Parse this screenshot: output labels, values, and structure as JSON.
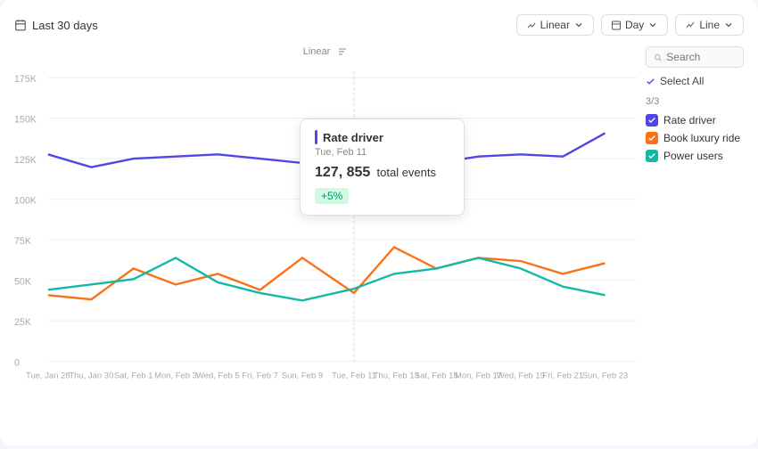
{
  "header": {
    "date_range": "Last 30 days",
    "calendar_icon": "calendar-icon",
    "linear_label": "Linear",
    "day_label": "Day",
    "line_label": "Line"
  },
  "chart": {
    "linear_label": "Linear",
    "sort_icon": "sort-icon",
    "y_axis": [
      "175K",
      "150K",
      "125K",
      "100K",
      "75K",
      "50K",
      "25K",
      "0"
    ],
    "x_axis": [
      "Tue, Jan 28",
      "Thu, Jan 30",
      "Sat, Feb 1",
      "Mon, Feb 3",
      "Wed, Feb 5",
      "Fri, Feb 7",
      "Sun, Feb 9",
      "Tue, Feb 11",
      "Thu, Feb 13",
      "Sat, Feb 15",
      "Mon, Feb 17",
      "Wed, Feb 19",
      "Fri, Feb 21",
      "Sun, Feb 23"
    ]
  },
  "tooltip": {
    "title": "Rate driver",
    "date": "Tue, Feb 11",
    "events_label": "total events",
    "events_count": "127, 855",
    "badge": "+5%"
  },
  "sidebar": {
    "search_placeholder": "Search",
    "select_all_label": "Select All",
    "count_label": "3/3",
    "legend_items": [
      {
        "label": "Rate driver",
        "color": "blue"
      },
      {
        "label": "Book luxury ride",
        "color": "orange"
      },
      {
        "label": "Power users",
        "color": "teal"
      }
    ]
  }
}
